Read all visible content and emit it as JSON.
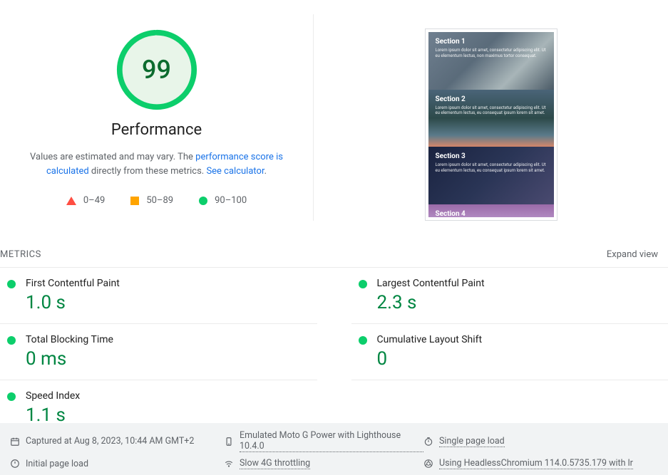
{
  "gauge": {
    "score": "99",
    "label": "Performance",
    "desc_prefix": "Values are estimated and may vary. The ",
    "link1": "performance score is calculated",
    "desc_mid": " directly from these metrics. ",
    "link2": "See calculator"
  },
  "legend": {
    "fail": "0–49",
    "avg": "50–89",
    "pass": "90–100"
  },
  "screenshot": {
    "s1_title": "Section 1",
    "s1_text": "Lorem ipsum dolor sit amet, consectetur adipiscing elit. Ut eu elementum lectus, non maximus tortor consequat.",
    "s2_title": "Section 2",
    "s2_text": "Lorem ipsum dolor sit amet, consectetur adipiscing elit. Ut eu elementum lectus, eu consequat ipsum lorem sit amet.",
    "s3_title": "Section 3",
    "s3_text": "Lorem ipsum dolor sit amet, consectetur adipiscing elit. Ut eu elementum lectus, eu consequat ipsum lorem sit amet.",
    "s4_title": "Section 4"
  },
  "metrics_header": {
    "title": "METRICS",
    "expand": "Expand view"
  },
  "metrics": {
    "fcp": {
      "label": "First Contentful Paint",
      "value": "1.0 s"
    },
    "lcp": {
      "label": "Largest Contentful Paint",
      "value": "2.3 s"
    },
    "tbt": {
      "label": "Total Blocking Time",
      "value": "0 ms"
    },
    "cls": {
      "label": "Cumulative Layout Shift",
      "value": "0"
    },
    "si": {
      "label": "Speed Index",
      "value": "1.1 s"
    }
  },
  "footer": {
    "captured": "Captured at Aug 8, 2023, 10:44 AM GMT+2",
    "emulated": "Emulated Moto G Power with Lighthouse 10.4.0",
    "single": "Single page load",
    "initial": "Initial page load",
    "throttle": "Slow 4G throttling",
    "chrome": "Using HeadlessChromium 114.0.5735.179 with lr"
  }
}
